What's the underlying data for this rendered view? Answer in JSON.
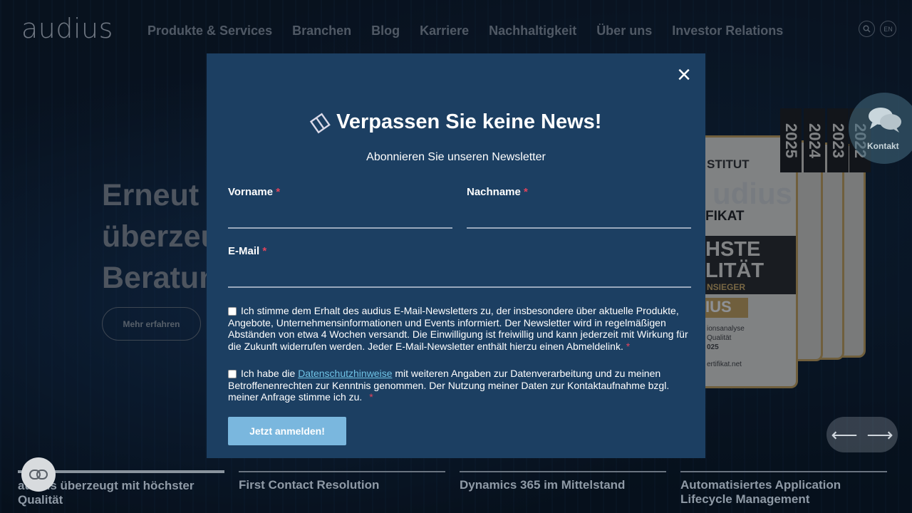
{
  "header": {
    "logo": "audius",
    "nav": [
      "Produkte & Services",
      "Branchen",
      "Blog",
      "Karriere",
      "Nachhaltigkeit",
      "Über uns",
      "Investor Relations"
    ],
    "search_icon": "search-icon",
    "lang": "EN"
  },
  "hero": {
    "title_lines": [
      "Erneut a",
      "überzeu",
      "Beratun"
    ],
    "button": "Mehr erfahren"
  },
  "certificate": {
    "line1": "STITUT",
    "line2": "FIKAT",
    "line3a": "HSTE",
    "line3b": "LITÄT",
    "line4": "NSIEGER",
    "gold": "IUS",
    "line5a": "ionsanalyse",
    "line5b": "Qualität",
    "line5c": "025",
    "line6": "ertifikat.net",
    "brand": "udius",
    "years": [
      "2025",
      "2024",
      "2023",
      "2022"
    ]
  },
  "kontakt": {
    "label": "Kontakt",
    "icon": "chat-icon"
  },
  "bottom_tabs": [
    "audius überzeugt mit höchster Qualität",
    "First Contact Resolution",
    "Dynamics 365 im Mittelstand",
    "Automatisiertes Application Lifecycle Management"
  ],
  "modal": {
    "title": "Verpassen Sie keine News!",
    "subtitle": "Abonnieren Sie unseren Newsletter",
    "fields": {
      "vorname": "Vorname",
      "nachname": "Nachname",
      "email": "E-Mail",
      "required_mark": "*"
    },
    "consent1": "Ich stimme dem Erhalt des audius E-Mail-Newsletters zu, der insbesondere über aktuelle Produkte, Angebote, Unternehmensinformationen und Events informiert. Der Newsletter wird in regelmäßigen Abständen von etwa 4 Wochen versandt. Die Einwilligung ist freiwillig und kann jederzeit mit Wirkung für die Zukunft widerrufen werden. Jeder E-Mail-Newsletter enthält hierzu einen Abmeldelink.",
    "consent2_pre": "Ich habe die",
    "consent2_link": "Datenschutzhinweise",
    "consent2_post": "mit weiteren Angaben zur Datenverarbeitung und zu meinen Betroffenenrechten zur Kenntnis genommen. Der Nutzung meiner Daten zur Kontaktaufnahme bzgl. meiner Anfrage stimme ich zu.",
    "submit": "Jetzt anmelden!",
    "close": "×"
  }
}
